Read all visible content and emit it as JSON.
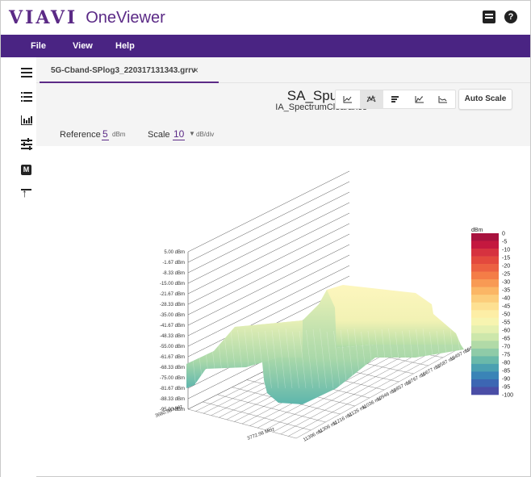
{
  "header": {
    "brand": "VIAVI",
    "app_name": "OneViewer",
    "book_icon": "book-icon",
    "help_icon": "?"
  },
  "menu": {
    "items": [
      "File",
      "View",
      "Help"
    ]
  },
  "rail": {
    "icons": [
      "hamburger-menu-icon",
      "list-icon",
      "bar-chart-icon",
      "tune-sliders-icon",
      "m-badge-icon",
      "upload-icon"
    ]
  },
  "tab": {
    "label": "5G-Cband-SPlog3_220317131343.grrv",
    "close": "×"
  },
  "view": {
    "title": "SA_Spurious",
    "subtitle": "IA_SpectrumClearance",
    "buttons": [
      "line-chart-icon",
      "spectrum-3d-icon",
      "list-view-icon",
      "area-chart-icon",
      "trend-chart-icon"
    ],
    "auto_scale": "Auto Scale"
  },
  "params": {
    "reference_label": "Reference",
    "reference_value": "5",
    "reference_unit": "dBm",
    "scale_label": "Scale",
    "scale_value": "10",
    "scale_unit": "dB/div"
  },
  "chart_data": {
    "type": "surface-3d",
    "z_axis_labels": [
      "5.00 dBm",
      "-1.67 dBm",
      "-8.33 dBm",
      "-15.00 dBm",
      "-21.67 dBm",
      "-28.33 dBm",
      "-35.00 dBm",
      "-41.67 dBm",
      "-48.33 dBm",
      "-55.00 dBm",
      "-61.67 dBm",
      "-68.33 dBm",
      "-75.00 dBm",
      "-81.67 dBm",
      "-88.33 dBm",
      "-95.00 dBm"
    ],
    "time_axis_labels": [
      "10407",
      "10497 ms",
      "10587 ms",
      "10677 ms",
      "10767 ms",
      "10857 ms",
      "10946 ms",
      "11036 ms",
      "11126 ms",
      "11216 ms",
      "11306 ms",
      "11396 ms"
    ],
    "freq_axis_first_label": "3680.98 MHz",
    "freq_axis_last_label": "3772.98 MHz",
    "colorbar_title": "dBm",
    "colorbar_ticks": [
      "0",
      "-5",
      "-10",
      "-15",
      "-20",
      "-25",
      "-30",
      "-35",
      "-40",
      "-45",
      "-50",
      "-55",
      "-60",
      "-65",
      "-70",
      "-75",
      "-80",
      "-85",
      "-90",
      "-95",
      "-100"
    ],
    "colorbar_colors": [
      "#a8123e",
      "#c4183f",
      "#d6323f",
      "#e3493d",
      "#ec6141",
      "#f47d47",
      "#f89a54",
      "#fbb665",
      "#fccd7b",
      "#fde092",
      "#fdeea6",
      "#f7f4b0",
      "#e5f0b0",
      "#cde7ab",
      "#b1daa7",
      "#8fcba8",
      "#6ab9aa",
      "#4ba0b1",
      "#3a84b7",
      "#3c66b3",
      "#4a4da6"
    ]
  }
}
